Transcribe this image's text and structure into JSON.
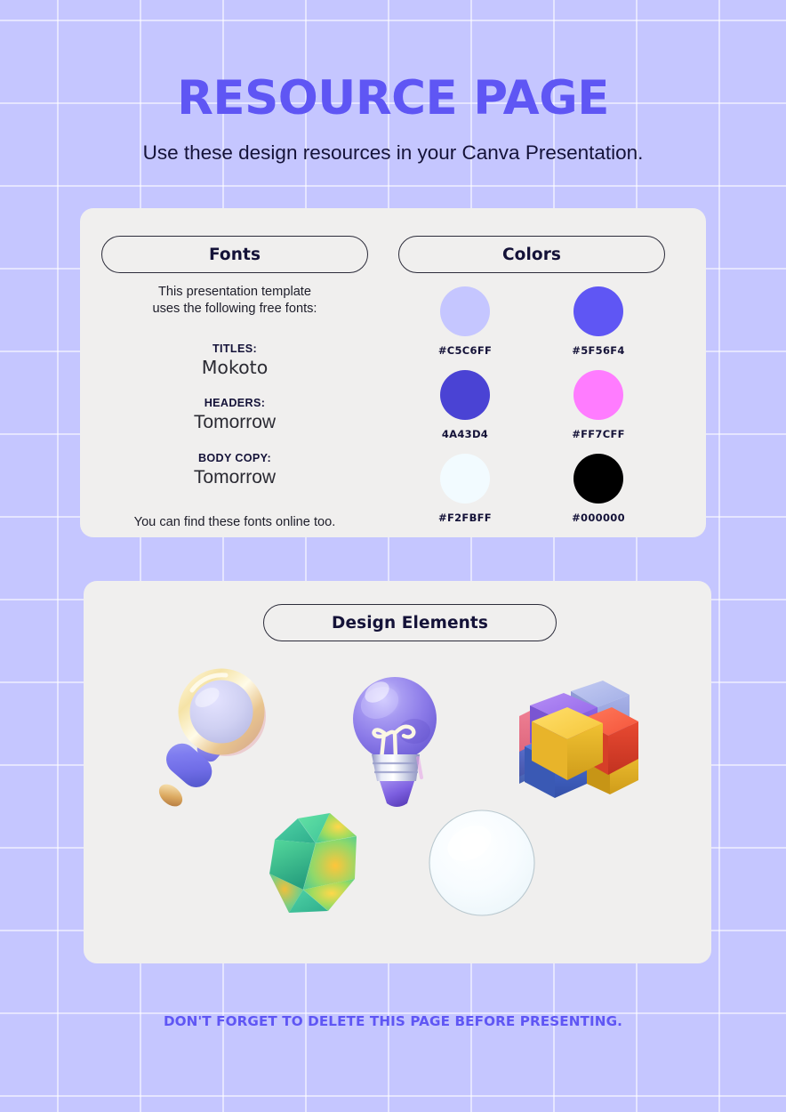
{
  "header": {
    "title": "RESOURCE PAGE",
    "subtitle": "Use these design resources in your Canva Presentation."
  },
  "fonts_card": {
    "pill_label": "Fonts",
    "intro_line_1": "This presentation template",
    "intro_line_2": "uses the following free fonts:",
    "entries": [
      {
        "role": "TITLES:",
        "name": "Mokoto"
      },
      {
        "role": "HEADERS:",
        "name": "Tomorrow"
      },
      {
        "role": "BODY COPY:",
        "name": "Tomorrow"
      }
    ],
    "outro": "You can find these fonts online too."
  },
  "colors_card": {
    "pill_label": "Colors",
    "swatches": [
      {
        "label": "#C5C6FF",
        "hex": "#c5c6ff"
      },
      {
        "label": "#5F56F4",
        "hex": "#5f56f4"
      },
      {
        "label": "4A43D4",
        "hex": "#4a43d4"
      },
      {
        "label": "#FF7CFF",
        "hex": "#ff7cff"
      },
      {
        "label": "#F2FBFF",
        "hex": "#f2fbff"
      },
      {
        "label": "#000000",
        "hex": "#000000"
      }
    ]
  },
  "design_elements_card": {
    "pill_label": "Design Elements",
    "elements": [
      {
        "name": "magnifying-glass-3d"
      },
      {
        "name": "lightbulb-3d"
      },
      {
        "name": "cube-cluster-3d"
      },
      {
        "name": "icosahedron-3d"
      },
      {
        "name": "sphere-3d"
      }
    ]
  },
  "footer": {
    "note": "DON'T FORGET TO DELETE THIS PAGE BEFORE PRESENTING."
  },
  "theme": {
    "background": "#c5c6ff",
    "grid_line": "#ffffff",
    "card_background": "#f0efee",
    "accent": "#5f56f4",
    "text_dark": "#141238"
  }
}
